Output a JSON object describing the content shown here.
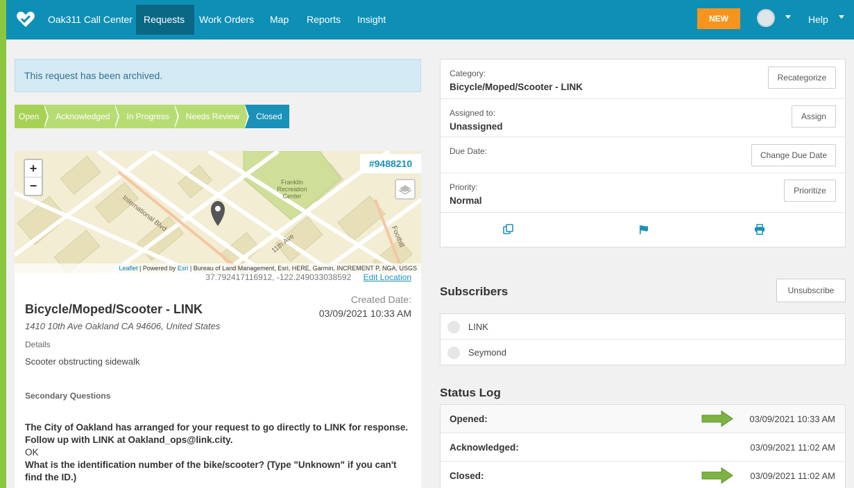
{
  "navbar": {
    "brand": "Oak311 Call Center",
    "links": [
      "Requests",
      "Work Orders",
      "Map",
      "Reports",
      "Insight"
    ],
    "new_label": "NEW",
    "help_label": "Help",
    "accent": "#0e8fb6",
    "active_bg": "#0a6885"
  },
  "banner": {
    "text": "This request has been archived."
  },
  "steps": [
    "Open",
    "Acknowledged",
    "In Progress",
    "Needs Review",
    "Closed"
  ],
  "map": {
    "ticket_id": "#9488210",
    "zoom_in": "+",
    "zoom_out": "−",
    "park_label_1": "Franklin",
    "park_label_2": "Recreation",
    "park_label_3": "Center",
    "street_1": "International Blvd",
    "street_2": "11th Ave",
    "street_3": "Foothill",
    "attribution_leaflet": "Leaflet",
    "attribution_rest": " | Powered by ",
    "attribution_esri": "Esri",
    "attribution_tail": " | Bureau of Land Management, Esri, HERE, Garmin, INCREMENT P, NGA, USGS",
    "coordinates": "37.792417116912, -122.249033038592",
    "edit_location": "Edit Location"
  },
  "request": {
    "title": "Bicycle/Moped/Scooter - LINK",
    "created_label": "Created Date:",
    "created_value": "03/09/2021 10:33 AM",
    "address": "1410 10th Ave Oakland CA 94606, United States",
    "details_label": "Details",
    "details_value": "Scooter obstructing sidewalk",
    "secondary_label": "Secondary Questions",
    "q1": "The City of Oakland has arranged for your request to go directly to LINK for response. Follow up with LINK at Oakland_ops@link.city.",
    "a1": "OK",
    "q2": "What is the identification number of the bike/scooter? (Type \"Unknown\" if you can't find the ID.)"
  },
  "info": {
    "category_label": "Category:",
    "category_value": "Bicycle/Moped/Scooter - LINK",
    "recategorize": "Recategorize",
    "assigned_label": "Assigned to:",
    "assigned_value": "Unassigned",
    "assign": "Assign",
    "due_label": "Due Date:",
    "change_due": "Change Due Date",
    "priority_label": "Priority:",
    "priority_value": "Normal",
    "prioritize": "Prioritize",
    "icons": [
      "copy-icon",
      "flag-icon",
      "print-icon"
    ]
  },
  "subscribers": {
    "title": "Subscribers",
    "unsubscribe": "Unsubscribe",
    "items": [
      "LINK",
      "Seymond"
    ]
  },
  "status_log": {
    "title": "Status Log",
    "rows": [
      {
        "label": "Opened:",
        "value": "03/09/2021 10:33 AM"
      },
      {
        "label": "Acknowledged:",
        "value": "03/09/2021 11:02 AM"
      },
      {
        "label": "Closed:",
        "value": "03/09/2021 11:02 AM"
      }
    ],
    "arrow_color": "#7cb342"
  }
}
